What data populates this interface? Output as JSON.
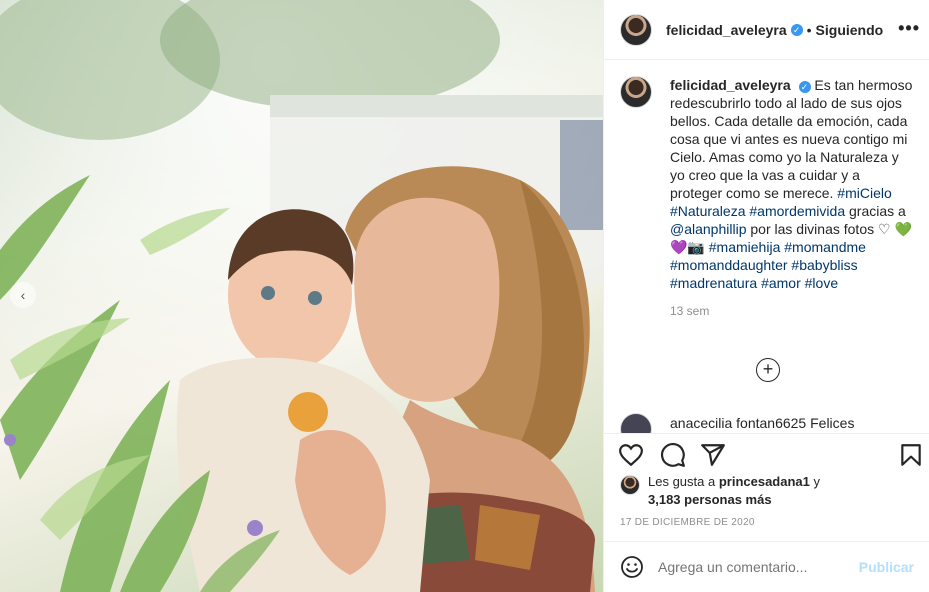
{
  "header": {
    "username": "felicidad_aveleyra",
    "verified_mark": "✓",
    "separator": "•",
    "follow_status": "Siguiendo",
    "more_label": "•••"
  },
  "caption": {
    "username": "felicidad_aveleyra",
    "text_1": "Es tan hermoso redescubrirlo todo al lado de sus ojos bellos. Cada detalle da emoción, cada cosa que vi antes es nueva contigo mi Cielo. Amas como yo la Naturaleza y yo creo que la vas a cuidar y a proteger como se merece. ",
    "tag_1": "#miCielo",
    "tag_2": "#Naturaleza",
    "tag_3": "#amordemivida",
    "text_2": " gracias a ",
    "mention": "@alanphillip",
    "text_3": " por las divinas fotos ",
    "emoji_1": "♡",
    "emoji_2": "💚💜📷",
    "tag_4": "#mamiehija",
    "tag_5": "#momandme",
    "tag_6": "#momanddaughter",
    "tag_7": "#babybliss",
    "tag_8": "#madrenatura",
    "tag_9": "#amor",
    "tag_10": "#love",
    "time": "13 sem"
  },
  "next_comment": {
    "text": "anacecilia fontan6625 Felices"
  },
  "load_more_icon": "plus-circle-icon",
  "actions": {
    "icons": [
      "heart-icon",
      "comment-icon",
      "share-icon",
      "bookmark-icon"
    ]
  },
  "likes": {
    "prefix": "Les gusta a ",
    "user": "princesadana1",
    "suffix": " y",
    "others": "3,183 personas más"
  },
  "date": "17 DE DICIEMBRE DE 2020",
  "comment_box": {
    "placeholder": "Agrega un comentario...",
    "post_label": "Publicar"
  },
  "colors": {
    "link": "#00376b",
    "verified": "#3897f0",
    "post_disabled": "#b2dffc",
    "muted": "#8e8e8e"
  }
}
